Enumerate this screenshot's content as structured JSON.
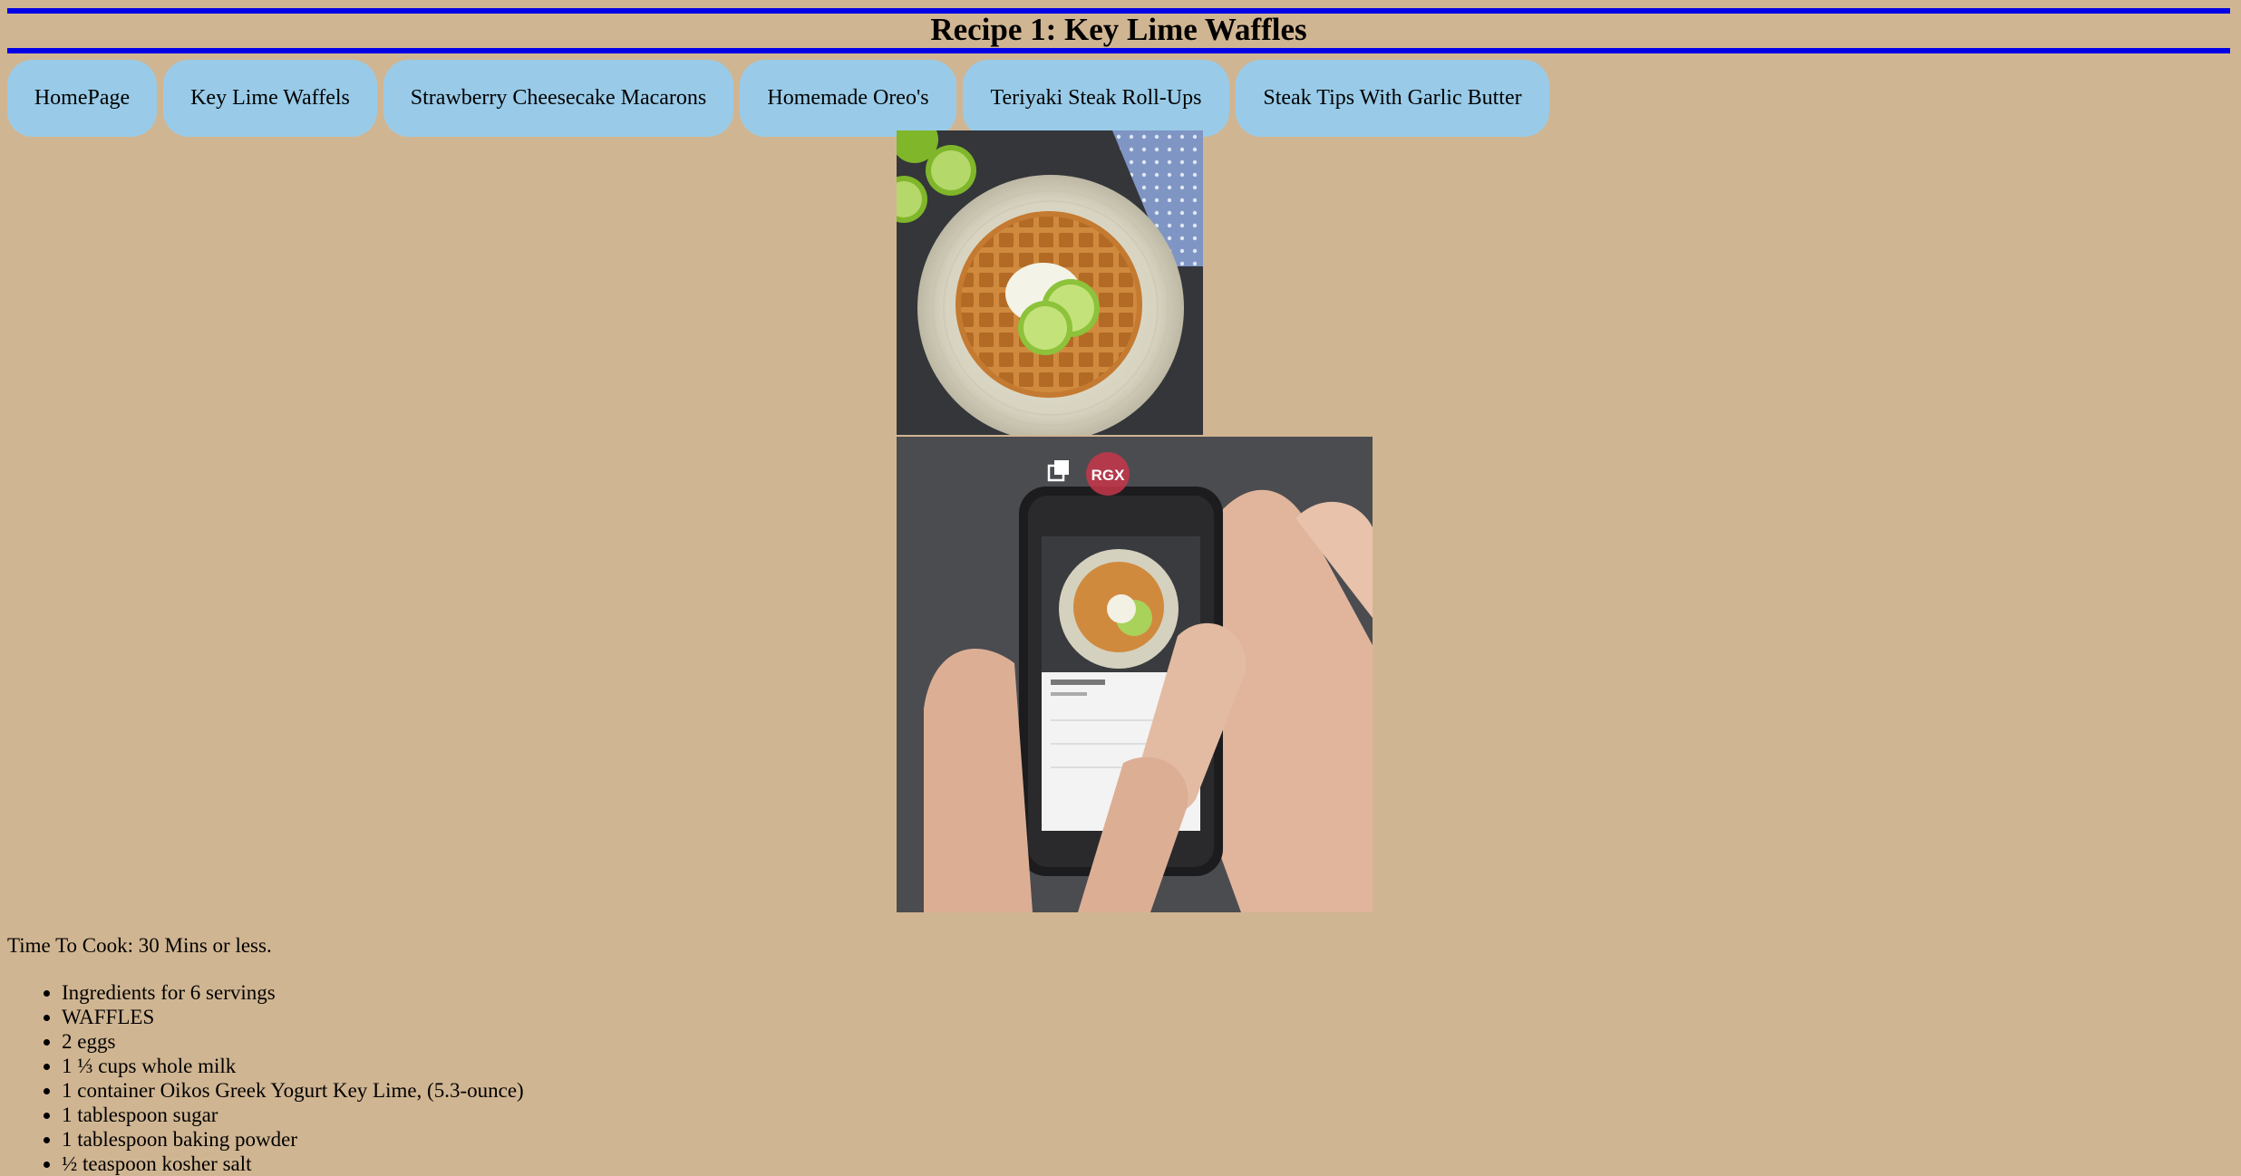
{
  "page": {
    "title": "Recipe 1: Key Lime Waffles"
  },
  "nav": {
    "items": [
      {
        "label": "HomePage"
      },
      {
        "label": "Key Lime Waffels"
      },
      {
        "label": "Strawberry Cheesecake Macarons"
      },
      {
        "label": "Homemade Oreo's"
      },
      {
        "label": "Teriyaki Steak Roll-Ups"
      },
      {
        "label": "Steak Tips With Garlic Butter"
      }
    ]
  },
  "images": {
    "video_badge": "RGX"
  },
  "recipe": {
    "time_to_cook": "Time To Cook: 30 Mins or less.",
    "ingredients": [
      "Ingredients for 6 servings",
      "WAFFLES",
      "2 eggs",
      "1 ⅓ cups whole milk",
      "1 container Oikos Greek Yogurt Key Lime, (5.3-ounce)",
      "1 tablespoon sugar",
      "1 tablespoon baking powder",
      "½ teaspoon kosher salt"
    ]
  },
  "colors": {
    "background": "#d0b592",
    "title_rule": "#0000e6",
    "nav_button": "#99cbe8"
  }
}
